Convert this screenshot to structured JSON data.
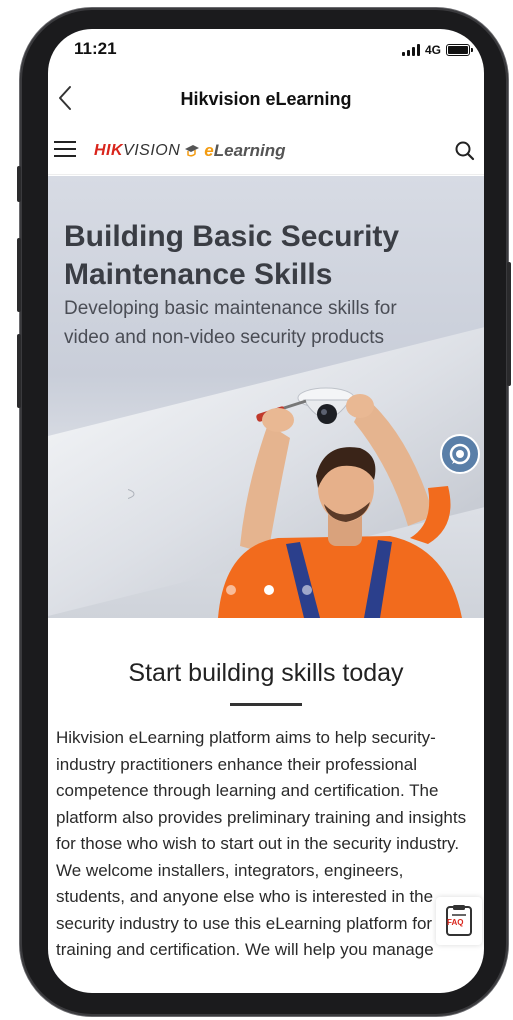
{
  "status_bar": {
    "time": "11:21",
    "network": "4G"
  },
  "title_bar": {
    "title": "Hikvision eLearning"
  },
  "site_header": {
    "logo_hik_bold": "HIK",
    "logo_hik_rest": "VISION",
    "logo_e": "e",
    "logo_learning": "Learning"
  },
  "hero": {
    "title": "Building Basic Security Maintenance Skills",
    "subtitle": "Developing basic maintenance skills for video and non-video security products",
    "slide_count": 3,
    "active_slide": 2
  },
  "main": {
    "heading": "Start building skills today",
    "paragraph_1": "Hikvision eLearning platform aims to help security-industry practitioners enhance their professional competence through learning and certification. The platform also provides preliminary training and insights for those who wish to start out in the security industry.",
    "paragraph_2": "We welcome installers, integrators, engineers, students, and anyone else who is interested in the security industry to use this eLearning platform for training and certification. We will help you manage"
  },
  "faq": {
    "label": "FAQ"
  },
  "colors": {
    "brand_red": "#d9251c",
    "accent_orange": "#f39c12",
    "worker_shirt": "#f26b1d"
  }
}
